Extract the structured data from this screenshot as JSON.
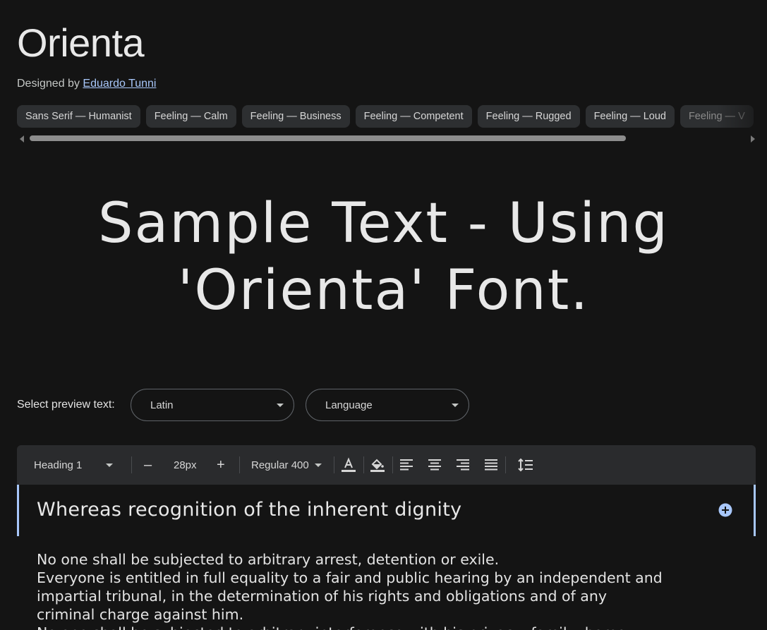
{
  "font": {
    "title": "Orienta",
    "designed_by_label": "Designed by",
    "designer_name": "Eduardo Tunni"
  },
  "tags": [
    "Sans Serif — Humanist",
    "Feeling — Calm",
    "Feeling — Business",
    "Feeling — Competent",
    "Feeling — Rugged",
    "Feeling — Loud",
    "Feeling — V"
  ],
  "sample_text": {
    "line1": "Sample Text - Using",
    "line2": "'Orienta' Font."
  },
  "preview_select": {
    "label": "Select preview text:",
    "script_value": "Latin",
    "language_value": "Language"
  },
  "toolbar": {
    "style_value": "Heading 1",
    "decrease_label": "–",
    "size_value": "28px",
    "increase_label": "+",
    "weight_value": "Regular 400"
  },
  "editor": {
    "heading": "Whereas recognition of the inherent dignity",
    "body_lines": [
      "No one shall be subjected to arbitrary arrest, detention or exile.",
      "Everyone is entitled in full equality to a fair and public hearing by an independent and",
      "impartial tribunal, in the determination of his rights and obligations and of any",
      "criminal charge against him.",
      "No one shall be subjected to arbitrary interference with his privacy, family, home"
    ]
  },
  "colors": {
    "background": "#141414",
    "chip_bg": "#2d2f31",
    "link": "#a8c7fa",
    "toolbar_bg": "#2a2b2d",
    "accent": "#a8c7fa"
  }
}
